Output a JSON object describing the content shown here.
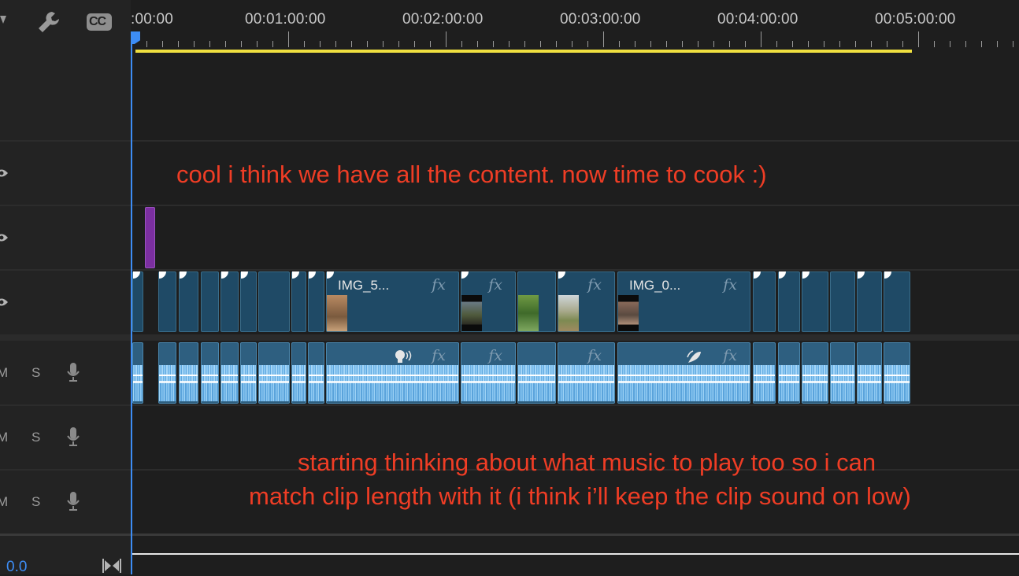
{
  "toolbar": {
    "icons": [
      "marker-icon",
      "wrench-icon",
      "cc-icon"
    ],
    "cc_label": "CC"
  },
  "ruler": {
    "timecodes": [
      ":00:00",
      "00:01:00:00",
      "00:02:00:00",
      "00:03:00:00",
      "00:04:00:00",
      "00:05:00:00"
    ]
  },
  "track_headers": {
    "audio_controls": [
      {
        "mute": "M",
        "solo": "S"
      },
      {
        "mute": "M",
        "solo": "S"
      },
      {
        "mute": "M",
        "solo": "S"
      }
    ],
    "master_value": "0.0"
  },
  "clips": {
    "video_labels": [
      "IMG_5...",
      "IMG_0..."
    ],
    "fx_label": "fx"
  },
  "annotations": {
    "top": "cool i think we have all the content. now time to cook :)",
    "bottom_line1": "starting thinking about what music to play too so i can",
    "bottom_line2": "match clip length with it (i think i’ll keep the clip sound on low)"
  },
  "colors": {
    "accent": "#3d8df5",
    "work_area": "#f0e040",
    "annotation": "#ef3d25",
    "video_clip": "#1f4a66",
    "audio_clip": "#2e5f80",
    "adjustment_clip": "#7b2fa0"
  }
}
